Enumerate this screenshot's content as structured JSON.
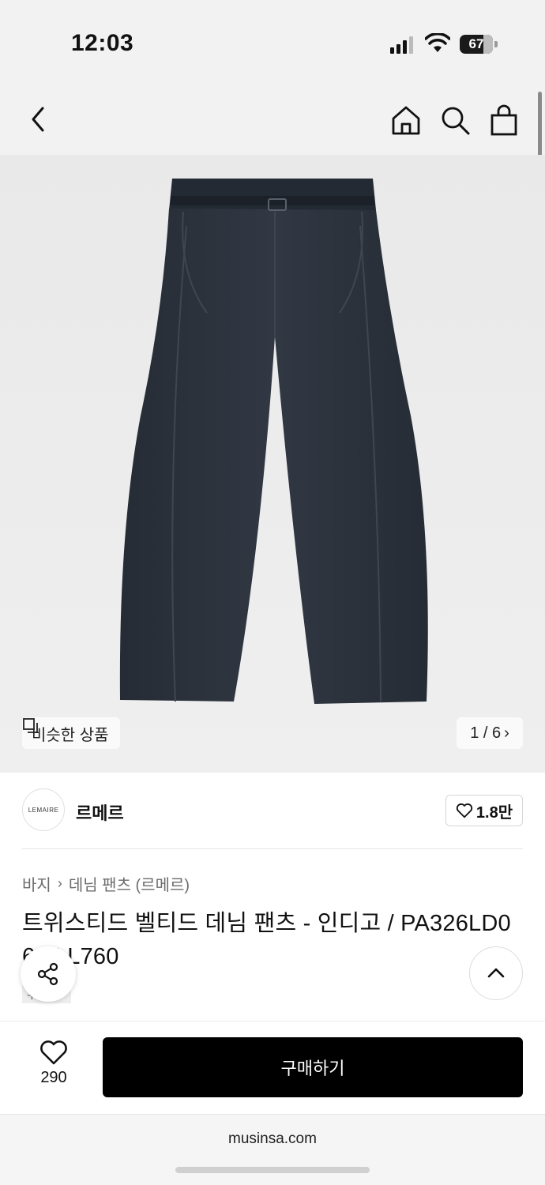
{
  "status_bar": {
    "time": "12:03",
    "battery": "67"
  },
  "nav": {
    "back": "back",
    "home": "home",
    "search": "search",
    "bag": "bag"
  },
  "gallery": {
    "similar_label": "비슷한 상품",
    "pager": "1 / 6"
  },
  "brand": {
    "logo_text": "LEMAIRE",
    "name": "르메르",
    "likes": "1.8만"
  },
  "breadcrumb": [
    "바지",
    "데님 팬츠 (르메르)"
  ],
  "product": {
    "title": "트위스티드 벨티드 데님 팬츠 - 인디고 / PA326LD06 3LL760",
    "tag": "무진스"
  },
  "bottom": {
    "wish_count": "290",
    "buy_label": "구매하기"
  },
  "browser": {
    "url": "musinsa.com"
  },
  "colors": {
    "denim": "#2b313a",
    "buy_button": "#000000",
    "background": "#f2f2f2"
  }
}
